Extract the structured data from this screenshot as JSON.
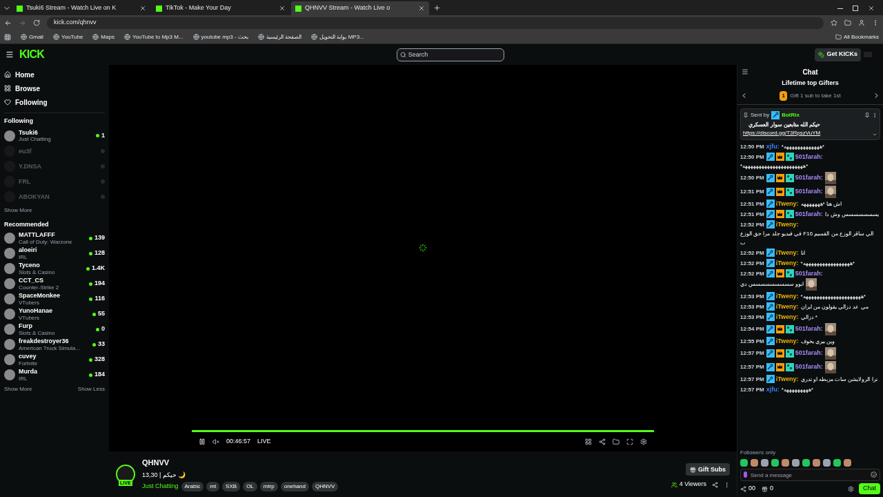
{
  "browser": {
    "tabs": [
      {
        "title": "Tsuki6 Stream - Watch Live on K",
        "selected": false
      },
      {
        "title": "TikTok - Make Your Day",
        "selected": false
      },
      {
        "title": "QHNVV Stream - Watch Live o",
        "selected": true
      }
    ],
    "address": "kick.com/qhnvv",
    "bookmarks": [
      "Gmail",
      "YouTube",
      "Maps",
      "YouTube to Mp3 M...",
      "youtube mp3 - بحث",
      "الصفحة الرئيسية",
      "بوابة التحويل MP3..."
    ],
    "all_bookmarks": "All Bookmarks"
  },
  "header": {
    "logo": "KICK",
    "search_placeholder": "Search",
    "get_kicks": "Get KICKs"
  },
  "nav": [
    "Home",
    "Browse",
    "Following"
  ],
  "following": {
    "title": "Following",
    "show_more": "Show More",
    "channels": [
      {
        "name": "Tsuki6",
        "category": "Just Chatting",
        "viewers": "1",
        "online": true
      },
      {
        "name": "eu3f",
        "online": false
      },
      {
        "name": "Y.DNSA",
        "online": false
      },
      {
        "name": "FRL",
        "online": false
      },
      {
        "name": "ABOKYAN",
        "online": false
      }
    ]
  },
  "recommended": {
    "title": "Recommended",
    "show_more": "Show More",
    "show_less": "Show Less",
    "channels": [
      {
        "name": "MATTLAFFF",
        "category": "Call of Duty: Warzone",
        "viewers": "139"
      },
      {
        "name": "aloeiri",
        "category": "IRL",
        "viewers": "128"
      },
      {
        "name": "Tyceno",
        "category": "Slots & Casino",
        "viewers": "1.4K"
      },
      {
        "name": "CCT_CS",
        "category": "Counter-Strike 2",
        "viewers": "194"
      },
      {
        "name": "SpaceMonkee",
        "category": "VTubers",
        "viewers": "116"
      },
      {
        "name": "YunoHanae",
        "category": "VTubers",
        "viewers": "55"
      },
      {
        "name": "Furp",
        "category": "Slots & Casino",
        "viewers": "0"
      },
      {
        "name": "freakdestroyer36",
        "category": "American Truck Simula...",
        "viewers": "33"
      },
      {
        "name": "cuvey",
        "category": "Fortnite",
        "viewers": "328"
      },
      {
        "name": "Murda",
        "category": "IRL",
        "viewers": "184"
      }
    ]
  },
  "player": {
    "progress": {
      "level": 1
    },
    "time": "00:46:57",
    "live": "LIVE"
  },
  "stream": {
    "channel": "QHNVV",
    "live_badge": "LIVE",
    "title": "13,30 | حيكم 🌙",
    "category": "Just Chatting",
    "tags": [
      "Arabic",
      "mt",
      "SXB",
      "OL",
      "mtrp",
      "onehand",
      "QHNVV"
    ],
    "gift_subs": "Gift Subs",
    "viewers": "4 Viewers"
  },
  "chat": {
    "title": "Chat",
    "gifters_title": "Lifetime top Gifters",
    "gifter_rank": "1",
    "gifters_hint": "Gift 1 sub to take 1st",
    "pinned": {
      "sent_by": "Sent by",
      "user": "BotRix",
      "text": "حيكم الله متابعين سوار العسكري",
      "link": "https://discord.gg/T3RpszVuYM"
    },
    "messages": [
      {
        "time": "12:50 PM",
        "user": "xjfu:",
        "color": "#3b82f6",
        "mod": false,
        "sub": false,
        "og": false,
        "text": "*هههههههههههههه*",
        "emote": false
      },
      {
        "time": "12:50 PM",
        "user": "501farah:",
        "color": "#a78bfa",
        "mod": true,
        "sub": true,
        "og": true,
        "text": "*ههههههههههههههههههههههه*",
        "emote": false
      },
      {
        "time": "12:50 PM",
        "user": "501farah:",
        "color": "#a78bfa",
        "mod": true,
        "sub": true,
        "og": true,
        "emote": true
      },
      {
        "time": "12:51 PM",
        "user": "501farah:",
        "color": "#a78bfa",
        "mod": true,
        "sub": true,
        "og": true,
        "emote": true
      },
      {
        "time": "12:51 PM",
        "user": "iTweny:",
        "color": "#eab308",
        "mod": true,
        "sub": false,
        "og": false,
        "text": "اش هنا *هههههههه",
        "emote": false
      },
      {
        "time": "12:51 PM",
        "user": "501farah:",
        "color": "#a78bfa",
        "mod": true,
        "sub": true,
        "og": true,
        "text": "يسسسسسسس وش دا",
        "emote": false
      },
      {
        "time": "12:52 PM",
        "user": "iTweny:",
        "color": "#eab308",
        "mod": true,
        "sub": false,
        "og": false,
        "text": "في فيديو جلد مرا حق الوزع F16 الي ساقر الوزع من القسيم ب",
        "emote": false
      },
      {
        "time": "12:52 PM",
        "user": "iTweny:",
        "color": "#eab308",
        "mod": true,
        "sub": false,
        "og": false,
        "text": "انا",
        "emote": false
      },
      {
        "time": "12:52 PM",
        "user": "iTweny:",
        "color": "#eab308",
        "mod": true,
        "sub": false,
        "og": false,
        "text": "*هههههههههههههههههه*",
        "emote": false
      },
      {
        "time": "12:52 PM",
        "user": "501farah:",
        "color": "#a78bfa",
        "mod": true,
        "sub": true,
        "og": true,
        "text": "ابوو سسسسسسسسس دي",
        "emote": true
      },
      {
        "time": "12:53 PM",
        "user": "iTweny:",
        "color": "#eab308",
        "mod": true,
        "sub": false,
        "og": false,
        "text": "*هههههههههههههههههههههه*",
        "emote": false
      },
      {
        "time": "12:53 PM",
        "user": "iTweny:",
        "color": "#eab308",
        "mod": true,
        "sub": false,
        "og": false,
        "text": "مي عد دزالي يقولون من ايران",
        "emote": false
      },
      {
        "time": "12:53 PM",
        "user": "iTweny:",
        "color": "#eab308",
        "mod": true,
        "sub": false,
        "og": false,
        "text": "دزالي *",
        "emote": false
      },
      {
        "time": "12:54 PM",
        "user": "501farah:",
        "color": "#a78bfa",
        "mod": true,
        "sub": true,
        "og": true,
        "emote": true
      },
      {
        "time": "12:55 PM",
        "user": "iTweny:",
        "color": "#eab308",
        "mod": true,
        "sub": false,
        "og": false,
        "text": "وين بيري يخوف",
        "emote": false
      },
      {
        "time": "12:57 PM",
        "user": "501farah:",
        "color": "#a78bfa",
        "mod": true,
        "sub": true,
        "og": true,
        "emote": true
      },
      {
        "time": "12:57 PM",
        "user": "501farah:",
        "color": "#a78bfa",
        "mod": true,
        "sub": true,
        "og": true,
        "emote": true
      },
      {
        "time": "12:57 PM",
        "user": "iTweny:",
        "color": "#eab308",
        "mod": true,
        "sub": false,
        "og": false,
        "text": "ترا الرولايشن سات مزبطه او تدري",
        "emote": false
      },
      {
        "time": "12:57 PM",
        "user": "xjfu:",
        "color": "#3b82f6",
        "mod": false,
        "sub": false,
        "og": false,
        "text": "*هههههههههه*",
        "emote": false
      }
    ],
    "followers_only": "Followers only",
    "placeholder": "Send a message",
    "points": "00",
    "count": "0",
    "send": "Chat"
  }
}
